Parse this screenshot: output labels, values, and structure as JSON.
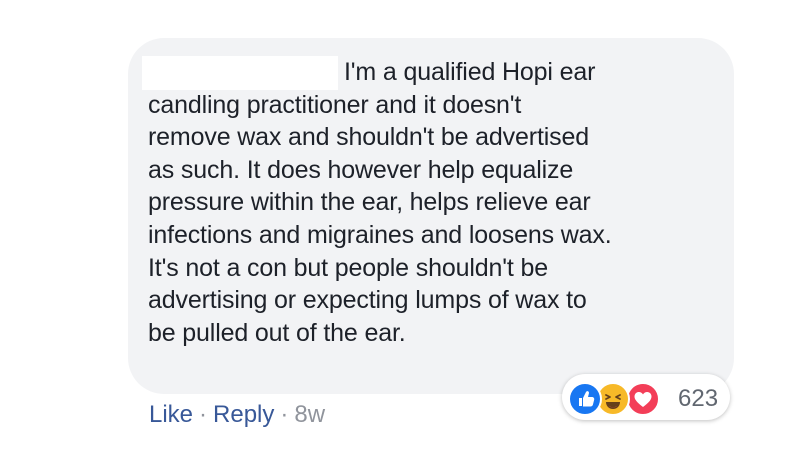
{
  "comment": {
    "lines": [
      "I'm a qualified Hopi ear",
      "candling practitioner and it doesn't",
      "remove wax and shouldn't be advertised",
      "as such. It does however help equalize",
      "pressure within the ear, helps relieve ear",
      "infections and migraines and loosens wax.",
      "It's not a con but people shouldn't be",
      "advertising or expecting lumps of wax to",
      "be pulled out of the ear."
    ]
  },
  "actions": {
    "like_label": "Like",
    "reply_label": "Reply",
    "separator": "·",
    "timestamp": "8w"
  },
  "reactions": {
    "icons": [
      "like-icon",
      "haha-icon",
      "love-icon"
    ],
    "count": "623"
  },
  "colors": {
    "bubble_bg": "#f2f3f5",
    "text": "#1d2129",
    "link": "#385898",
    "meta": "#90949c",
    "like_blue": "#1877f2",
    "haha_yellow": "#f7b928",
    "love_red": "#f33e58"
  }
}
